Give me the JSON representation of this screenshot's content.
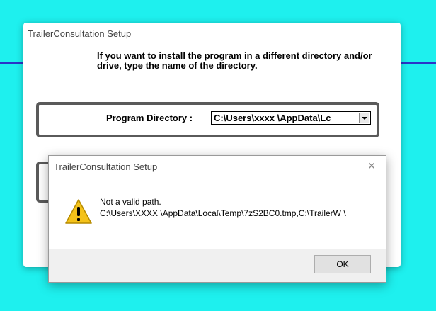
{
  "setup_window": {
    "title": "TrailerConsultation Setup",
    "instructions": "If you want to install the program in a different directory and/or drive, type the name of the directory.",
    "directory_label": "Program Directory  :",
    "directory_value": "C:\\Users\\xxxx \\AppData\\Lc"
  },
  "error_dialog": {
    "title": "TrailerConsultation  Setup",
    "close_glyph": "×",
    "heading": "Not a valid path.",
    "path_text": "C:\\Users\\XXXX \\AppData\\Local\\Temp\\7zS2BC0.tmp,C:\\TrailerW \\",
    "ok_label": "OK"
  },
  "colors": {
    "desktop": "#1ef0ee",
    "accent_line": "#2a35c8"
  },
  "icons": {
    "warning": "warning-icon",
    "dropdown": "chevron-down-icon",
    "close": "close-icon"
  }
}
